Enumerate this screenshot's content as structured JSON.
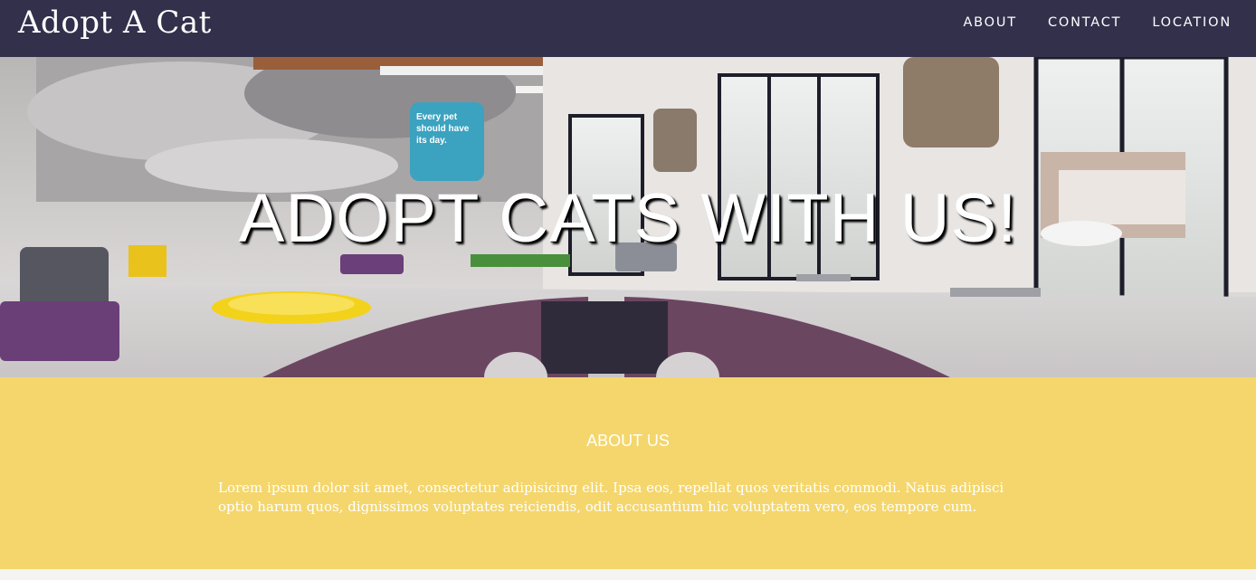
{
  "header": {
    "brand": "Adopt A Cat",
    "nav": [
      {
        "label": "ABOUT"
      },
      {
        "label": "CONTACT"
      },
      {
        "label": "LOCATION"
      }
    ]
  },
  "hero": {
    "title": "ADOPT CATS WITH US!",
    "poster_text": [
      "Every pet",
      "should have",
      "its day."
    ]
  },
  "about": {
    "heading": "ABOUT US",
    "body": "Lorem ipsum dolor sit amet, consectetur adipisicing elit. Ipsa eos, repellat quos veritatis commodi. Natus adipisci optio harum quos, dignissimos voluptates reiciendis, odit accusantium hic voluptatem vero, eos tempore cum."
  },
  "colors": {
    "navbar": "#33304b",
    "about_bg": "#f4d66c",
    "footer_bg": "#f5f4f2"
  }
}
